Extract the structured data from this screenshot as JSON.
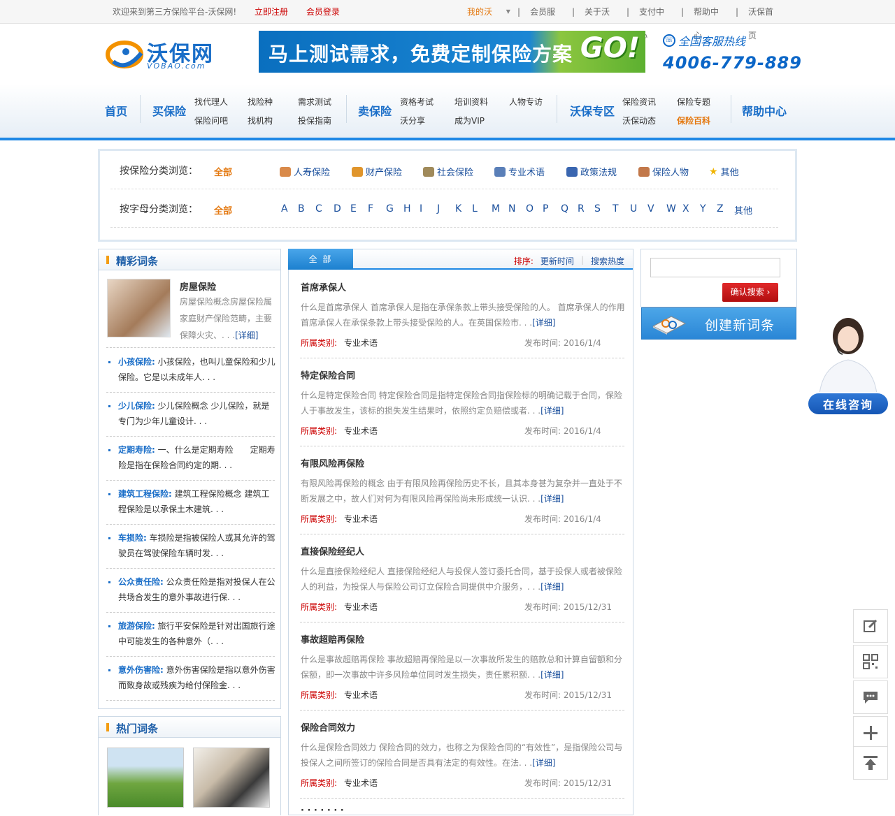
{
  "topbar": {
    "welcome": "欢迎来到第三方保险平台-沃保网!",
    "register": "立即注册",
    "login": "会员登录",
    "my_vobao": "我的沃保",
    "links": [
      "会员服务",
      "关于沃保",
      "支付中心",
      "帮助中心",
      "沃保首页"
    ]
  },
  "header": {
    "logo_text": "沃保网",
    "logo_sub": "VOBAO.com",
    "banner_text": "马上测试需求，免费定制保险方案",
    "banner_go": "GO!",
    "hotline_label": "全国客服热线",
    "hotline_number": "4006-779-889"
  },
  "nav": {
    "home": "首页",
    "buy": "买保险",
    "buy_links": [
      "找代理人",
      "找险种",
      "需求测试",
      "保险问吧",
      "找机构",
      "投保指南"
    ],
    "sell": "卖保险",
    "sell_links": [
      "资格考试",
      "培训资料",
      "人物专访",
      "沃分享",
      "成为VIP"
    ],
    "zone": "沃保专区",
    "zone_links": [
      "保险资讯",
      "保险专题",
      "沃保动态",
      "保险百科"
    ],
    "help": "帮助中心"
  },
  "categories": {
    "by_type_label": "按保险分类浏览：",
    "by_letter_label": "按字母分类浏览：",
    "all": "全部",
    "types": [
      {
        "label": "人寿保险",
        "icon": "people-icon",
        "color": "#d98a4a"
      },
      {
        "label": "财产保险",
        "icon": "house-icon",
        "color": "#e0952c"
      },
      {
        "label": "社会保险",
        "icon": "card-icon",
        "color": "#a08a5a"
      },
      {
        "label": "专业术语",
        "icon": "user-chat-icon",
        "color": "#5a7fb8"
      },
      {
        "label": "政策法规",
        "icon": "flag-icon",
        "color": "#3a66b0"
      },
      {
        "label": "保险人物",
        "icon": "people-icon",
        "color": "#c2784a"
      },
      {
        "label": "其他",
        "icon": "star-icon",
        "color": "#f0b400"
      }
    ],
    "letters": [
      "A",
      "B",
      "C",
      "D",
      "E",
      "F",
      "G",
      "H",
      "I",
      "J",
      "K",
      "L",
      "M",
      "N",
      "O",
      "P",
      "Q",
      "R",
      "S",
      "T",
      "U",
      "V",
      "W",
      "X",
      "Y",
      "Z"
    ],
    "letters_other": "其他"
  },
  "featured": {
    "title": "精彩词条",
    "main": {
      "title": "房屋保险",
      "text": "房屋保险概念房屋保险属家庭财产保险范畴，主要保障火灾、. . .",
      "detail": "[详细]"
    },
    "items": [
      {
        "key": "小孩保险:",
        "text": "小孩保险，也叫儿童保险和少儿保险。它是以未成年人. . ."
      },
      {
        "key": "少儿保险:",
        "text": "少儿保险概念 少儿保险，就是专门为少年儿童设计. . ."
      },
      {
        "key": "定期寿险:",
        "text": "一、什么是定期寿险　　定期寿险是指在保险合同约定的期. . ."
      },
      {
        "key": "建筑工程保险:",
        "text": "建筑工程保险概念 建筑工程保险是以承保土木建筑. . ."
      },
      {
        "key": "车损险:",
        "text": "车损险是指被保险人或其允许的驾驶员在驾驶保险车辆时发. . ."
      },
      {
        "key": "公众责任险:",
        "text": "公众责任险是指对投保人在公共场合发生的意外事故进行保. . ."
      },
      {
        "key": "旅游保险:",
        "text": "旅行平安保险是针对出国旅行途中可能发生的各种意外（. . ."
      },
      {
        "key": "意外伤害险:",
        "text": "意外伤害保险是指以意外伤害而致身故或残疾为给付保险金. . ."
      }
    ]
  },
  "hot": {
    "title": "热门词条"
  },
  "list": {
    "tab": "全 部",
    "sort_label": "排序:",
    "sort_time": "更新时间",
    "sort_hot": "搜索热度",
    "category_label": "所属类别:",
    "date_label": "发布时间:",
    "detail": "[详细]",
    "entries": [
      {
        "title": "首席承保人",
        "desc": "什么是首席承保人 首席承保人是指在承保条款上带头接受保险的人。 首席承保人的作用首席承保人在承保条款上带头接受保险的人。在英国保险市. . .",
        "category": "专业术语",
        "date": "2016/1/4"
      },
      {
        "title": "特定保险合同",
        "desc": "什么是特定保险合同 特定保险合同是指特定保险合同指保险标的明确记载于合同，保险人于事故发生，该标的损失发生结果时，依照约定负赔偿或者. . .",
        "category": "专业术语",
        "date": "2016/1/4"
      },
      {
        "title": "有限风险再保险",
        "desc": "有限风险再保险的概念 由于有限风险再保险历史不长，且其本身甚为复杂并一直处于不断发展之中，故人们对何为有限风险再保险尚未形成统一认识. . .",
        "category": "专业术语",
        "date": "2016/1/4"
      },
      {
        "title": "直接保险经纪人",
        "desc": "什么是直接保险经纪人 直接保险经纪人与投保人签订委托合同，基于投保人或者被保险人的利益，为投保人与保险公司订立保险合同提供中介服务，. . .",
        "category": "专业术语",
        "date": "2015/12/31"
      },
      {
        "title": "事故超赔再保险",
        "desc": "什么是事故超赔再保险 事故超赔再保险是以一次事故所发生的赔款总和计算自留额和分保额，即一次事故中许多风险单位同时发生损失，责任累积额. . .",
        "category": "专业术语",
        "date": "2015/12/31"
      },
      {
        "title": "保险合同效力",
        "desc": "什么是保险合同效力 保险合同的效力，也称之为保险合同的“有效性”，是指保险公司与投保人之间所签订的保险合同是否具有法定的有效性。在法. . .",
        "category": "专业术语",
        "date": "2015/12/31"
      }
    ]
  },
  "search": {
    "placeholder": "",
    "button": "确认搜索 ›"
  },
  "create": {
    "label": "创建新词条"
  },
  "consult": {
    "label": "在线咨询"
  },
  "side_tools": [
    "edit-icon",
    "qrcode-icon",
    "chat-icon",
    "plus-icon",
    "back-to-top-icon"
  ]
}
